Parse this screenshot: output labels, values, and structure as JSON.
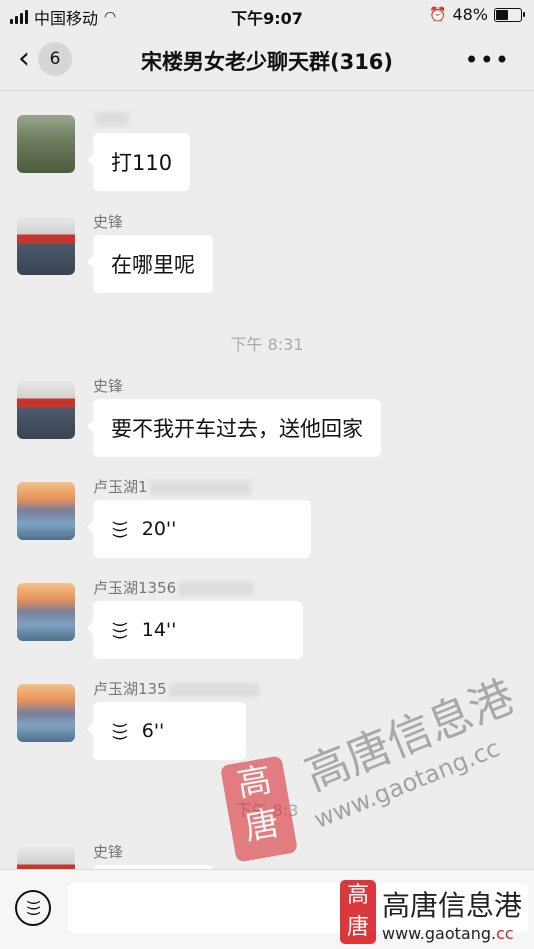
{
  "status_bar": {
    "carrier": "中国移动",
    "time": "下午9:07",
    "battery": "48%",
    "battery_level": 0.48
  },
  "header": {
    "unread_count": "6",
    "title": "宋楼男女老少聊天群(316)",
    "more_icon": "more-dots-icon"
  },
  "messages": [
    {
      "sender": "",
      "text": "打110",
      "avatar": "forest-avatar"
    },
    {
      "sender": "史锋",
      "text": "在哪里呢",
      "avatar": "shopfront-avatar"
    },
    {
      "timestamp": "下午 8:31"
    },
    {
      "sender": "史锋",
      "text": "要不我开车过去，送他回家",
      "avatar": "shopfront-avatar"
    },
    {
      "sender": "卢玉湖1",
      "voice_duration": "20''",
      "avatar": "waterfall-avatar"
    },
    {
      "sender": "卢玉湖1356",
      "voice_duration": "14''",
      "avatar": "waterfall-avatar"
    },
    {
      "sender": "卢玉湖135",
      "voice_duration": "6''",
      "avatar": "waterfall-avatar"
    },
    {
      "timestamp": "下午 8:3"
    },
    {
      "sender": "史锋",
      "avatar": "shopfront-avatar"
    }
  ],
  "watermark": {
    "seal_text": "高唐",
    "calligraphy": "高唐信息港",
    "url": "www.gaotang.cc",
    "url_main": "www.gaotang.",
    "url_tld": "cc"
  },
  "colors": {
    "background": "#ededed",
    "bubble": "#ffffff",
    "seal_red": "#d8232a"
  }
}
